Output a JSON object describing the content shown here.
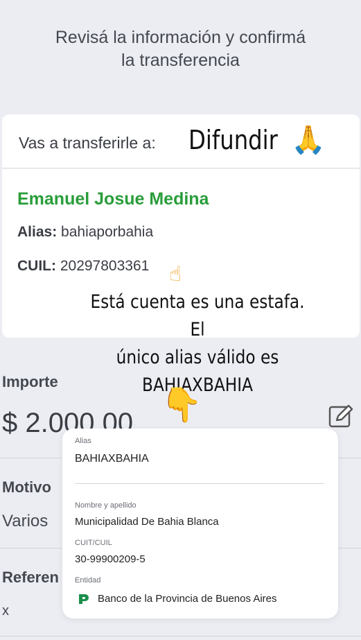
{
  "header": {
    "title_line1": "Revisá la información y confirmá",
    "title_line2": "la transferencia"
  },
  "recipient": {
    "prefix": "Vas a transferirle a:",
    "name": "Emanuel Josue Medina",
    "alias_label": "Alias:",
    "alias_value": "bahiaporbahia",
    "cuil_label": "CUIL:",
    "cuil_value": "20297803361"
  },
  "stickers": {
    "difundir": "Difundir",
    "warning_line1": "Está cuenta es una estafa. El",
    "warning_line2": "único alias válido es",
    "warning_line3": "BAHIAXBAHIA",
    "pray_emoji": "🙏",
    "point_up_emoji": "☝",
    "point_down_emoji": "👇"
  },
  "transfer": {
    "importe_label": "Importe",
    "importe_value": "$ 2.000,00",
    "motivo_label": "Motivo",
    "motivo_value": "Varios",
    "referencia_label": "Referen",
    "referencia_value": "x"
  },
  "popup": {
    "alias_label": "Alias",
    "alias_value": "BAHIAXBAHIA",
    "name_label": "Nombre y apellido",
    "name_value": "Municipalidad De Bahia Blanca",
    "cuit_label": "CUIT/CUIL",
    "cuit_value": "30-99900209-5",
    "entity_label": "Entidad",
    "entity_value": "Banco de la Provincia de Buenos Aires"
  },
  "colors": {
    "name_green": "#2a9d3a",
    "background": "#ecedf3",
    "bank_green": "#1a8f4a"
  },
  "icons": {
    "edit": "edit-icon",
    "bank": "bank-provincia-icon"
  }
}
